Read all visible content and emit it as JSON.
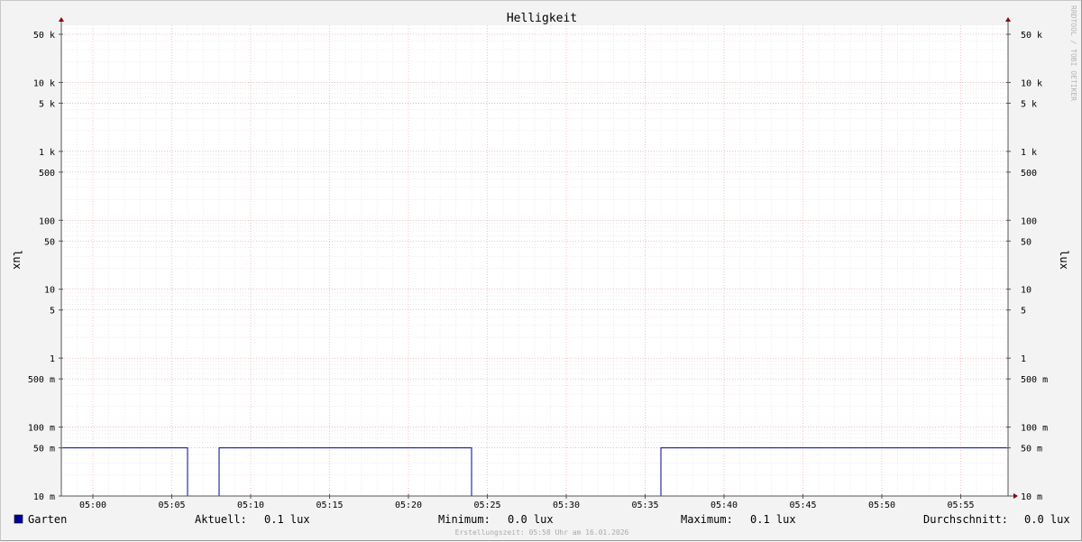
{
  "chart_data": {
    "type": "line",
    "title": "Helligkeit",
    "ylabel": "lux",
    "ylabel_right": "lux",
    "y_scale": "log",
    "ylim": [
      0.01,
      80000
    ],
    "y_ticks": [
      {
        "value": 50000,
        "label": "50 k"
      },
      {
        "value": 10000,
        "label": "10 k"
      },
      {
        "value": 5000,
        "label": "5 k"
      },
      {
        "value": 1000,
        "label": "1 k"
      },
      {
        "value": 500,
        "label": "500"
      },
      {
        "value": 100,
        "label": "100"
      },
      {
        "value": 50,
        "label": "50"
      },
      {
        "value": 10,
        "label": "10"
      },
      {
        "value": 5,
        "label": "5"
      },
      {
        "value": 1,
        "label": "1"
      },
      {
        "value": 0.5,
        "label": "500 m"
      },
      {
        "value": 0.1,
        "label": "100 m"
      },
      {
        "value": 0.05,
        "label": "50 m"
      },
      {
        "value": 0.01,
        "label": "10 m"
      }
    ],
    "x_ticks": [
      "05:00",
      "05:05",
      "05:10",
      "05:15",
      "05:20",
      "05:25",
      "05:30",
      "05:35",
      "05:40",
      "05:45",
      "05:50",
      "05:55"
    ],
    "xlim": [
      "04:58",
      "05:58"
    ],
    "grid": true,
    "series": [
      {
        "name": "Garten",
        "color": "#000099",
        "points": [
          {
            "t": "04:58",
            "v": 0.05
          },
          {
            "t": "05:06",
            "v": 0.05
          },
          {
            "t": "05:06",
            "v": 0.01
          },
          {
            "t": "05:08",
            "v": 0.01
          },
          {
            "t": "05:08",
            "v": 0.05
          },
          {
            "t": "05:24",
            "v": 0.05
          },
          {
            "t": "05:24",
            "v": 0.01
          },
          {
            "t": "05:36",
            "v": 0.01
          },
          {
            "t": "05:36",
            "v": 0.05
          },
          {
            "t": "05:58",
            "v": 0.05
          }
        ]
      }
    ],
    "legend": {
      "swatch_color": "#000099",
      "series_name": "Garten",
      "stats": [
        {
          "label": "Aktuell:",
          "value": "0.1 lux"
        },
        {
          "label": "Minimum:",
          "value": "0.0 lux"
        },
        {
          "label": "Maximum:",
          "value": "0.1 lux"
        },
        {
          "label": "Durchschnitt:",
          "value": "0.0 lux"
        }
      ]
    },
    "footer": "Erstellungszeit: 05:58 Uhr am 16.01.2026",
    "watermark": "RRDTOOL / TOBI OETIKER"
  }
}
